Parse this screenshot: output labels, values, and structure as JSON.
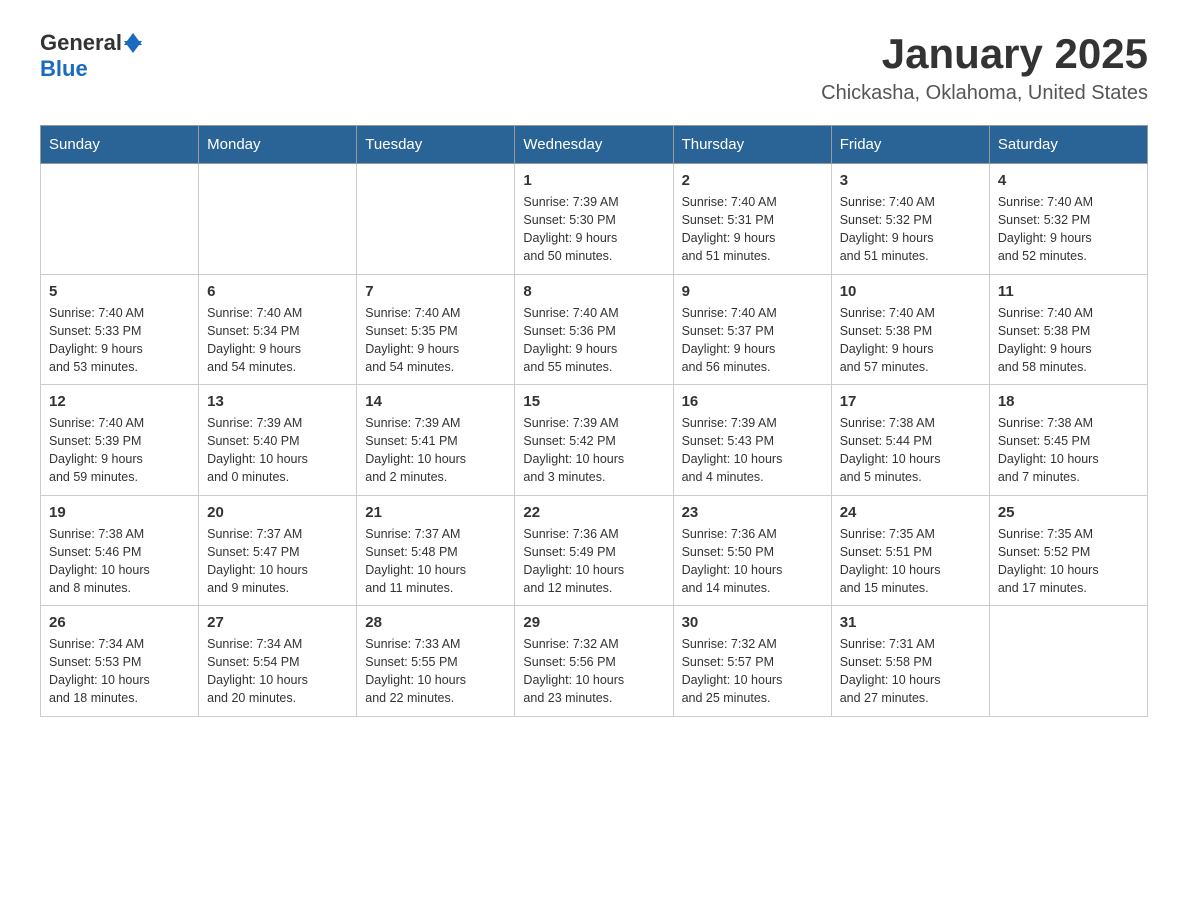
{
  "header": {
    "logo_general": "General",
    "logo_blue": "Blue",
    "title": "January 2025",
    "subtitle": "Chickasha, Oklahoma, United States"
  },
  "weekdays": [
    "Sunday",
    "Monday",
    "Tuesday",
    "Wednesday",
    "Thursday",
    "Friday",
    "Saturday"
  ],
  "weeks": [
    [
      {
        "day": "",
        "info": ""
      },
      {
        "day": "",
        "info": ""
      },
      {
        "day": "",
        "info": ""
      },
      {
        "day": "1",
        "info": "Sunrise: 7:39 AM\nSunset: 5:30 PM\nDaylight: 9 hours\nand 50 minutes."
      },
      {
        "day": "2",
        "info": "Sunrise: 7:40 AM\nSunset: 5:31 PM\nDaylight: 9 hours\nand 51 minutes."
      },
      {
        "day": "3",
        "info": "Sunrise: 7:40 AM\nSunset: 5:32 PM\nDaylight: 9 hours\nand 51 minutes."
      },
      {
        "day": "4",
        "info": "Sunrise: 7:40 AM\nSunset: 5:32 PM\nDaylight: 9 hours\nand 52 minutes."
      }
    ],
    [
      {
        "day": "5",
        "info": "Sunrise: 7:40 AM\nSunset: 5:33 PM\nDaylight: 9 hours\nand 53 minutes."
      },
      {
        "day": "6",
        "info": "Sunrise: 7:40 AM\nSunset: 5:34 PM\nDaylight: 9 hours\nand 54 minutes."
      },
      {
        "day": "7",
        "info": "Sunrise: 7:40 AM\nSunset: 5:35 PM\nDaylight: 9 hours\nand 54 minutes."
      },
      {
        "day": "8",
        "info": "Sunrise: 7:40 AM\nSunset: 5:36 PM\nDaylight: 9 hours\nand 55 minutes."
      },
      {
        "day": "9",
        "info": "Sunrise: 7:40 AM\nSunset: 5:37 PM\nDaylight: 9 hours\nand 56 minutes."
      },
      {
        "day": "10",
        "info": "Sunrise: 7:40 AM\nSunset: 5:38 PM\nDaylight: 9 hours\nand 57 minutes."
      },
      {
        "day": "11",
        "info": "Sunrise: 7:40 AM\nSunset: 5:38 PM\nDaylight: 9 hours\nand 58 minutes."
      }
    ],
    [
      {
        "day": "12",
        "info": "Sunrise: 7:40 AM\nSunset: 5:39 PM\nDaylight: 9 hours\nand 59 minutes."
      },
      {
        "day": "13",
        "info": "Sunrise: 7:39 AM\nSunset: 5:40 PM\nDaylight: 10 hours\nand 0 minutes."
      },
      {
        "day": "14",
        "info": "Sunrise: 7:39 AM\nSunset: 5:41 PM\nDaylight: 10 hours\nand 2 minutes."
      },
      {
        "day": "15",
        "info": "Sunrise: 7:39 AM\nSunset: 5:42 PM\nDaylight: 10 hours\nand 3 minutes."
      },
      {
        "day": "16",
        "info": "Sunrise: 7:39 AM\nSunset: 5:43 PM\nDaylight: 10 hours\nand 4 minutes."
      },
      {
        "day": "17",
        "info": "Sunrise: 7:38 AM\nSunset: 5:44 PM\nDaylight: 10 hours\nand 5 minutes."
      },
      {
        "day": "18",
        "info": "Sunrise: 7:38 AM\nSunset: 5:45 PM\nDaylight: 10 hours\nand 7 minutes."
      }
    ],
    [
      {
        "day": "19",
        "info": "Sunrise: 7:38 AM\nSunset: 5:46 PM\nDaylight: 10 hours\nand 8 minutes."
      },
      {
        "day": "20",
        "info": "Sunrise: 7:37 AM\nSunset: 5:47 PM\nDaylight: 10 hours\nand 9 minutes."
      },
      {
        "day": "21",
        "info": "Sunrise: 7:37 AM\nSunset: 5:48 PM\nDaylight: 10 hours\nand 11 minutes."
      },
      {
        "day": "22",
        "info": "Sunrise: 7:36 AM\nSunset: 5:49 PM\nDaylight: 10 hours\nand 12 minutes."
      },
      {
        "day": "23",
        "info": "Sunrise: 7:36 AM\nSunset: 5:50 PM\nDaylight: 10 hours\nand 14 minutes."
      },
      {
        "day": "24",
        "info": "Sunrise: 7:35 AM\nSunset: 5:51 PM\nDaylight: 10 hours\nand 15 minutes."
      },
      {
        "day": "25",
        "info": "Sunrise: 7:35 AM\nSunset: 5:52 PM\nDaylight: 10 hours\nand 17 minutes."
      }
    ],
    [
      {
        "day": "26",
        "info": "Sunrise: 7:34 AM\nSunset: 5:53 PM\nDaylight: 10 hours\nand 18 minutes."
      },
      {
        "day": "27",
        "info": "Sunrise: 7:34 AM\nSunset: 5:54 PM\nDaylight: 10 hours\nand 20 minutes."
      },
      {
        "day": "28",
        "info": "Sunrise: 7:33 AM\nSunset: 5:55 PM\nDaylight: 10 hours\nand 22 minutes."
      },
      {
        "day": "29",
        "info": "Sunrise: 7:32 AM\nSunset: 5:56 PM\nDaylight: 10 hours\nand 23 minutes."
      },
      {
        "day": "30",
        "info": "Sunrise: 7:32 AM\nSunset: 5:57 PM\nDaylight: 10 hours\nand 25 minutes."
      },
      {
        "day": "31",
        "info": "Sunrise: 7:31 AM\nSunset: 5:58 PM\nDaylight: 10 hours\nand 27 minutes."
      },
      {
        "day": "",
        "info": ""
      }
    ]
  ]
}
